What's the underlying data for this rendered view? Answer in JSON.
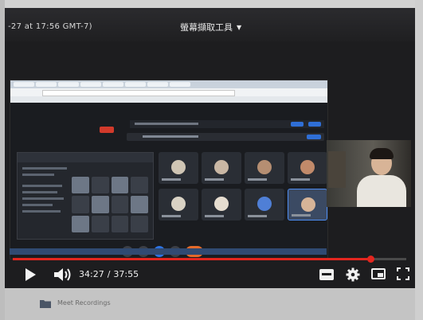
{
  "header": {
    "timestamp_title": "-27 at 17:56 GMT-7)",
    "tool_menu_label": "螢幕擷取工具",
    "tool_menu_icon": "chevron-down-icon"
  },
  "player": {
    "current_time": "34:27",
    "separator": "/",
    "duration": "37:55",
    "progress_fraction": 0.909,
    "accent_color": "#e3261f",
    "controls": {
      "play_icon": "play-icon",
      "volume_icon": "volume-icon",
      "captions_icon": "captions-icon",
      "settings_icon": "gear-icon",
      "miniplayer_icon": "miniplayer-icon",
      "fullscreen_icon": "fullscreen-icon"
    }
  },
  "below": {
    "folder_icon": "folder-icon",
    "folder_label": "Meet Recordings"
  }
}
